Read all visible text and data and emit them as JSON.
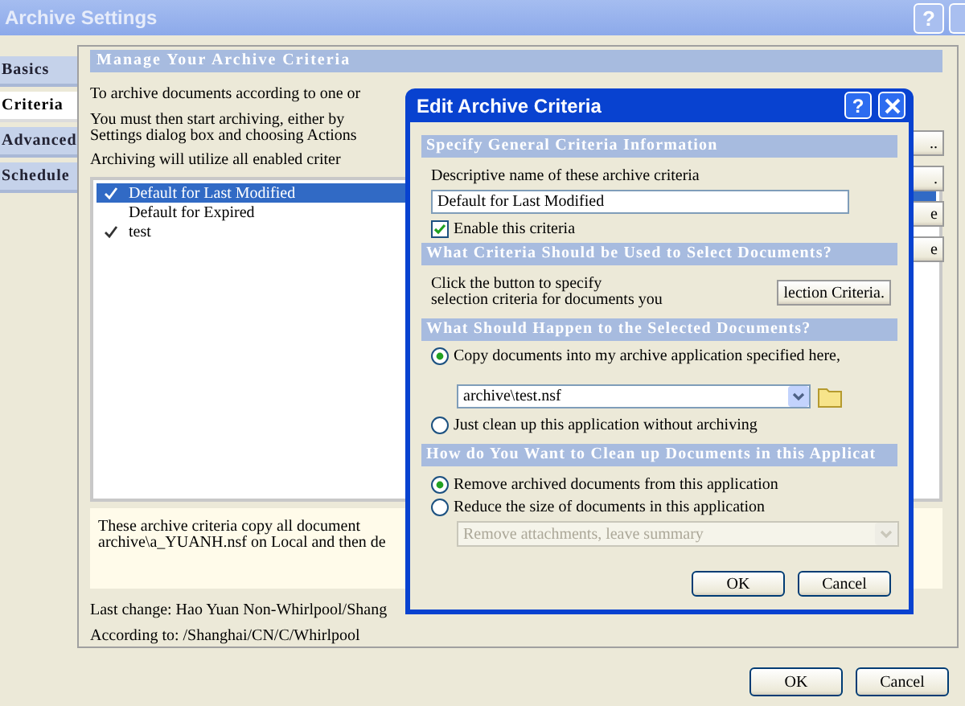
{
  "window": {
    "title": "Archive Settings",
    "help_button": "?"
  },
  "tabs": [
    {
      "label": "Basics",
      "selected": false
    },
    {
      "label": "Criteria",
      "selected": true
    },
    {
      "label": "Advanced",
      "selected": false
    },
    {
      "label": "Schedule",
      "selected": false
    }
  ],
  "criteria_panel": {
    "heading": "Manage Your Archive Criteria",
    "intro_lines": [
      "To archive documents according to one or",
      "You must then start archiving, either by",
      "Settings dialog box and choosing Actions"
    ],
    "note": "Archiving will utilize all enabled criter",
    "criteria": [
      {
        "name": "Default for Last Modified",
        "enabled": true,
        "selected": true
      },
      {
        "name": "Default for Expired",
        "enabled": false,
        "selected": false
      },
      {
        "name": "test",
        "enabled": true,
        "selected": false
      }
    ],
    "side_buttons": [
      "..",
      ".",
      "e",
      "e"
    ],
    "description_lines": [
      "These archive criteria copy all document",
      "archive\\a_YUANH.nsf on Local and then de"
    ],
    "last_change": "Last change: Hao Yuan Non-Whirlpool/Shang",
    "according_to": "According to: /Shanghai/CN/C/Whirlpool"
  },
  "buttons": [
    "OK",
    "Cancel"
  ],
  "dialog": {
    "title": "Edit Archive Criteria",
    "help_button": "?",
    "general": {
      "heading": "Specify General Criteria Information",
      "name_label": "Descriptive name of these archive criteria",
      "name_value": "Default for Last Modified",
      "enable": {
        "label": "Enable this criteria",
        "checked": true
      }
    },
    "selection": {
      "heading": "What Criteria Should be Used to Select Documents?",
      "text_lines": [
        "Click the button to specify",
        "selection criteria for documents you"
      ],
      "button": "lection Criteria."
    },
    "action": {
      "heading": "What Should Happen to the Selected Documents?",
      "options": [
        {
          "label": "Copy documents into my archive application specified here,",
          "selected": true
        },
        {
          "label": "Just clean up this application without archiving",
          "selected": false
        }
      ],
      "archive_path": "archive\\test.nsf"
    },
    "cleanup": {
      "heading": "How do You Want to Clean up Documents in this Applicat",
      "options": [
        {
          "label": "Remove archived documents from this application",
          "selected": true
        },
        {
          "label": "Reduce the size of documents in this application",
          "selected": false
        }
      ],
      "reduce_choice": {
        "value": "Remove attachments, leave summary",
        "disabled": true
      }
    },
    "buttons": [
      "OK",
      "Cancel"
    ]
  }
}
